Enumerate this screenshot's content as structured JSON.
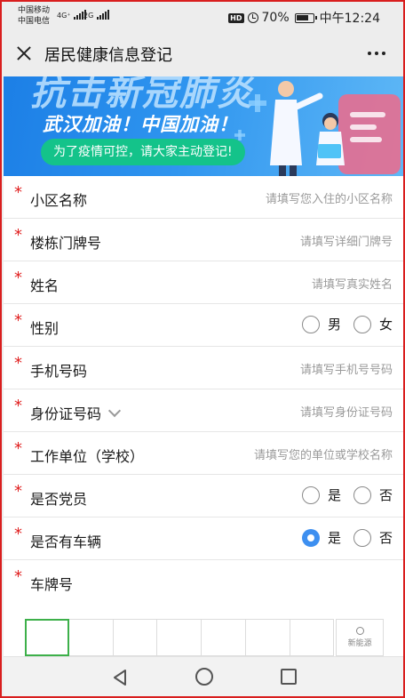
{
  "status_bar": {
    "carrier_1": "中国移动",
    "carrier_2": "中国电信",
    "sig_1_type": "4G⁺",
    "sig_2_type": "2G",
    "battery": "70%",
    "time": "中午12:24",
    "hd": "HD"
  },
  "nav": {
    "title": "居民健康信息登记",
    "close_icon": "close-icon",
    "more_icon": "more-icon"
  },
  "banner": {
    "headline": "抗击新冠肺炎",
    "subline": "武汉加油！中国加油！",
    "pill": "为了疫情可控，请大家主动登记!",
    "colors": {
      "bg": "#2f95ef",
      "pill": "#14c38a"
    }
  },
  "form": {
    "required_mark": "*",
    "fields": [
      {
        "label": "小区名称",
        "placeholder": "请填写您入住的小区名称"
      },
      {
        "label": "楼栋门牌号",
        "placeholder": "请填写详细门牌号"
      },
      {
        "label": "姓名",
        "placeholder": "请填写真实姓名"
      },
      {
        "label": "性别",
        "options": [
          "男",
          "女"
        ]
      },
      {
        "label": "手机号码",
        "placeholder": "请填写手机号号码"
      },
      {
        "label": "身份证号码",
        "placeholder": "请填写身份证号码"
      },
      {
        "label": "工作单位（学校）",
        "placeholder": "请填写您的单位或学校名称"
      },
      {
        "label": "是否党员",
        "options": [
          "是",
          "否"
        ]
      },
      {
        "label": "是否有车辆",
        "options": [
          "是",
          "否"
        ],
        "selected": "是"
      },
      {
        "label": "车牌号"
      }
    ],
    "plate": {
      "new_energy_label": "新能源",
      "accent": "#3db04a"
    }
  },
  "colors": {
    "required": "#e02020",
    "radio_checked": "#3d8ff0",
    "frame": "#d91e1e"
  }
}
